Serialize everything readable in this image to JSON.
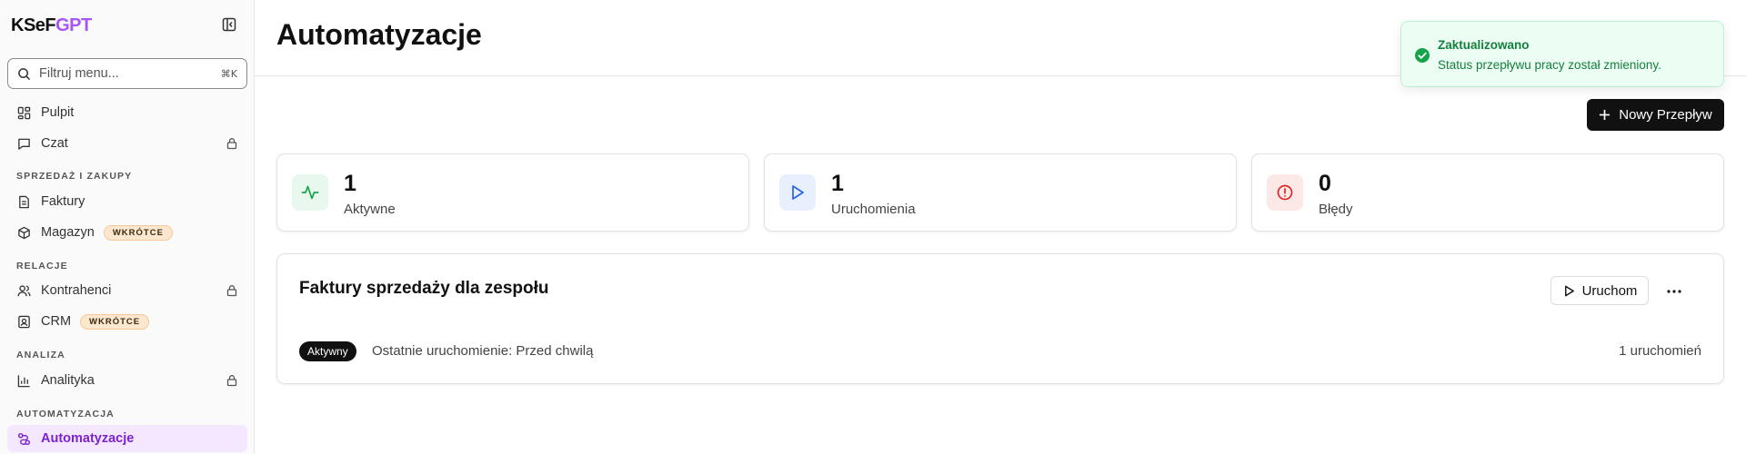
{
  "brand": {
    "part1": "KSeF",
    "part2": "GPT"
  },
  "search": {
    "placeholder": "Filtruj menu...",
    "shortcut": "⌘K"
  },
  "sidebar": {
    "top_items": [
      {
        "label": "Pulpit"
      },
      {
        "label": "Czat",
        "locked": true
      }
    ],
    "sections": [
      {
        "title": "SPRZEDAŻ I ZAKUPY",
        "items": [
          {
            "label": "Faktury"
          },
          {
            "label": "Magazyn",
            "badge": "WKRÓTCE"
          }
        ]
      },
      {
        "title": "RELACJE",
        "items": [
          {
            "label": "Kontrahenci",
            "locked": true
          },
          {
            "label": "CRM",
            "badge": "WKRÓTCE"
          }
        ]
      },
      {
        "title": "ANALIZA",
        "items": [
          {
            "label": "Analityka",
            "locked": true
          }
        ]
      },
      {
        "title": "AUTOMATYZACJA",
        "items": [
          {
            "label": "Automatyzacje",
            "active": true
          }
        ]
      }
    ]
  },
  "page": {
    "title": "Automatyzacje",
    "new_button": "Nowy Przepływ"
  },
  "stats": [
    {
      "value": "1",
      "label": "Aktywne",
      "icon": "activity-icon",
      "color": "#16a34a",
      "bg": "#e8f8ee"
    },
    {
      "value": "1",
      "label": "Uruchomienia",
      "icon": "play-icon",
      "color": "#2563eb",
      "bg": "#e8effd"
    },
    {
      "value": "0",
      "label": "Błędy",
      "icon": "alert-circle-icon",
      "color": "#dc2626",
      "bg": "#fde8e8"
    }
  ],
  "workflow": {
    "title": "Faktury sprzedaży dla zespołu",
    "run_button": "Uruchom",
    "status": "Aktywny",
    "last_run": "Ostatnie uruchomienie: Przed chwilą",
    "run_count": "1 uruchomień"
  },
  "toast": {
    "title": "Zaktualizowano",
    "message": "Status przepływu pracy został zmieniony.",
    "color": "#15803d"
  }
}
